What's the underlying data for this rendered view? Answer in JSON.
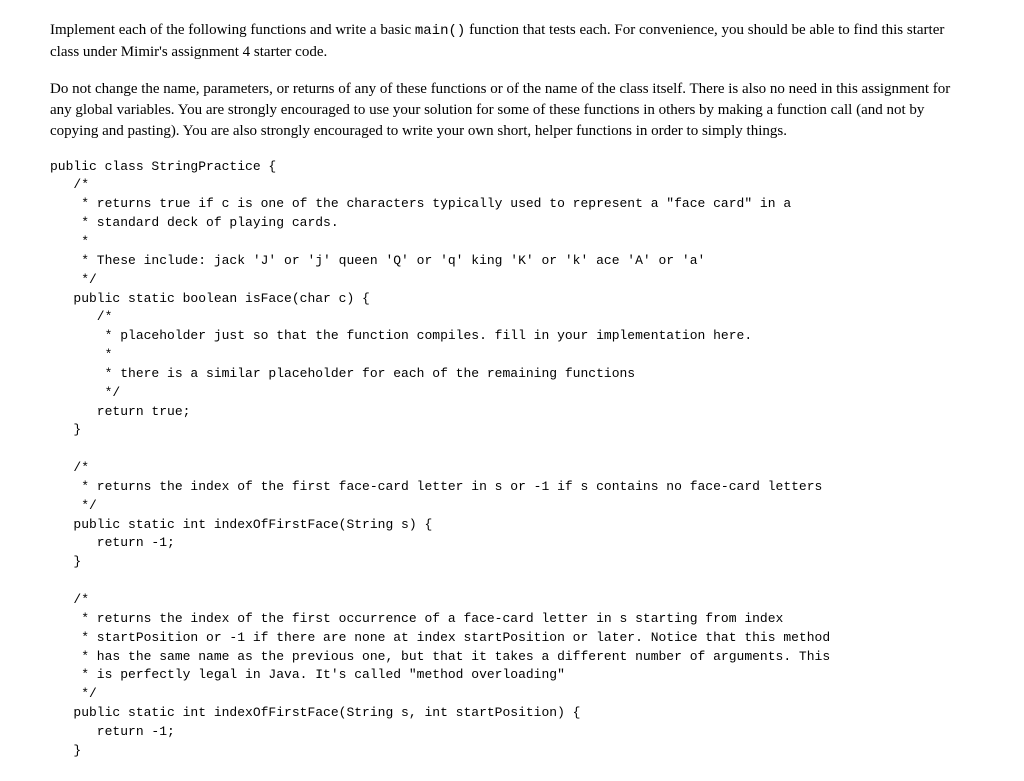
{
  "para1_a": "Implement each of the following functions and write a basic ",
  "para1_b": "main()",
  "para1_c": " function that tests each. For convenience, you should be able to find this starter class under Mimir's assignment 4 starter code.",
  "para2": "Do not change the name, parameters, or returns of any of these functions or of the name of the class itself. There is also no need in this assignment for any global variables. You are strongly encouraged to use your solution for some of these functions in others by making a function call (and not by copying and pasting). You are also strongly encouraged to write your own short, helper functions in order to simply things.",
  "code": "public class StringPractice {\n   /*\n    * returns true if c is one of the characters typically used to represent a \"face card\" in a\n    * standard deck of playing cards.\n    *\n    * These include: jack 'J' or 'j' queen 'Q' or 'q' king 'K' or 'k' ace 'A' or 'a'\n    */\n   public static boolean isFace(char c) {\n      /*\n       * placeholder just so that the function compiles. fill in your implementation here.\n       *\n       * there is a similar placeholder for each of the remaining functions\n       */\n      return true;\n   }\n\n   /*\n    * returns the index of the first face-card letter in s or -1 if s contains no face-card letters\n    */\n   public static int indexOfFirstFace(String s) {\n      return -1;\n   }\n\n   /*\n    * returns the index of the first occurrence of a face-card letter in s starting from index\n    * startPosition or -1 if there are none at index startPosition or later. Notice that this method\n    * has the same name as the previous one, but that it takes a different number of arguments. This\n    * is perfectly legal in Java. It's called \"method overloading\"\n    */\n   public static int indexOfFirstFace(String s, int startPosition) {\n      return -1;\n   }"
}
